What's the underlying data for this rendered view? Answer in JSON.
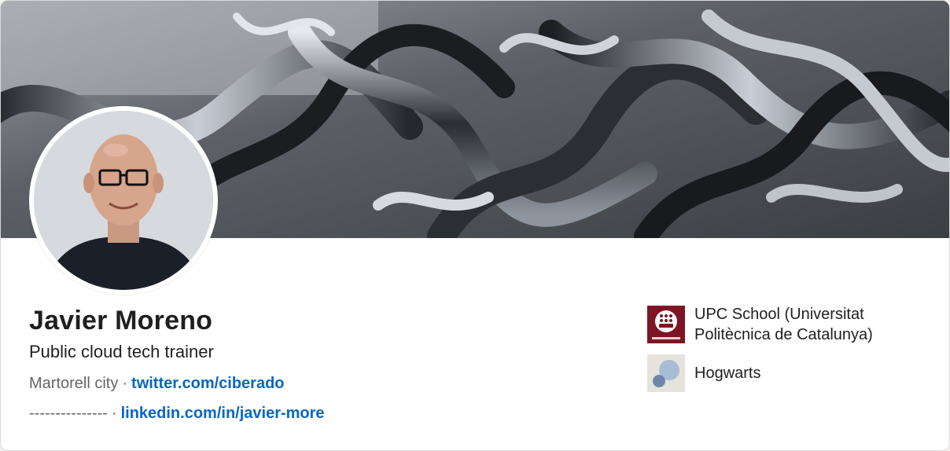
{
  "profile": {
    "name": "Javier Moreno",
    "headline": "Public cloud tech trainer",
    "location": "Martorell city",
    "twitter": "twitter.com/ciberado",
    "divider_text": "---------------",
    "linkedin": "linkedin.com/in/javier-more",
    "separator": "·"
  },
  "organizations": [
    {
      "name": "UPC School (Universitat Politècnica de Catalunya)",
      "logo_icon": "upc-school-logo-icon",
      "logo_color": "#8b1a2b"
    },
    {
      "name": "Hogwarts",
      "logo_icon": "generic-school-logo-icon",
      "logo_color": "#a9bcd6"
    }
  ],
  "colors": {
    "link": "#0a66c2",
    "text": "#1f1f1f",
    "muted": "#666666",
    "card": "#ffffff"
  }
}
